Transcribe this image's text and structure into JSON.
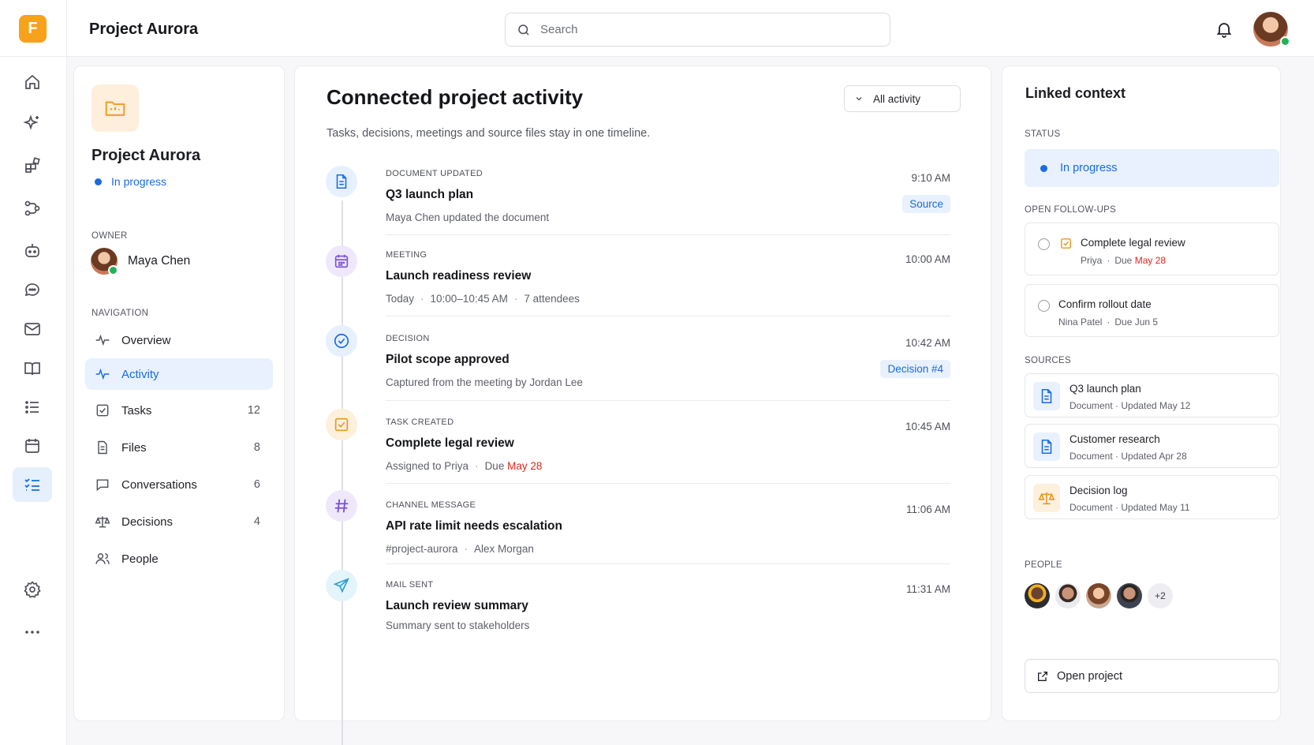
{
  "app": {
    "logo_letter": "F",
    "title": "Project Aurora"
  },
  "search": {
    "placeholder": "Search"
  },
  "rail": {
    "items": [
      {
        "name": "home-icon"
      },
      {
        "name": "sparkle-icon"
      },
      {
        "name": "apps-icon"
      },
      {
        "name": "workflow-icon"
      },
      {
        "name": "bot-icon"
      },
      {
        "name": "chat-icon"
      },
      {
        "name": "mail-icon"
      },
      {
        "name": "book-icon"
      },
      {
        "name": "list-icon"
      },
      {
        "name": "calendar-icon"
      },
      {
        "name": "checklist-icon",
        "active": true
      }
    ],
    "bottom": [
      {
        "name": "settings-icon"
      },
      {
        "name": "more-icon"
      }
    ]
  },
  "project": {
    "name": "Project Aurora",
    "status": "In progress",
    "owner_label": "OWNER",
    "owner_name": "Maya Chen",
    "nav_label": "NAVIGATION",
    "nav": [
      {
        "label": "Overview",
        "count": ""
      },
      {
        "label": "Activity",
        "count": "",
        "active": true
      },
      {
        "label": "Tasks",
        "count": "12"
      },
      {
        "label": "Files",
        "count": "8"
      },
      {
        "label": "Conversations",
        "count": "6"
      },
      {
        "label": "Decisions",
        "count": "4"
      },
      {
        "label": "People",
        "count": ""
      }
    ]
  },
  "main": {
    "title": "Connected project activity",
    "filter_label": "All activity",
    "subtitle": "Tasks, decisions, meetings and source files stay in one timeline.",
    "events": [
      {
        "type": "DOCUMENT UPDATED",
        "title": "Q3 launch plan",
        "meta": [
          "Maya Chen updated the document"
        ],
        "time": "9:10 AM",
        "tag": "Source"
      },
      {
        "type": "MEETING",
        "title": "Launch readiness review",
        "meta": [
          "Today",
          "10:00–10:45 AM",
          "7 attendees"
        ],
        "time": "10:00 AM"
      },
      {
        "type": "DECISION",
        "title": "Pilot scope approved",
        "meta": [
          "Captured from the meeting by Jordan Lee"
        ],
        "time": "10:42 AM",
        "tag": "Decision #4"
      },
      {
        "type": "TASK CREATED",
        "title": "Complete legal review",
        "meta_a": "Assigned to Priya",
        "meta_b": "Due",
        "meta_due": "May 28",
        "time": "10:45 AM"
      },
      {
        "type": "CHANNEL MESSAGE",
        "title": "API rate limit needs escalation",
        "meta": [
          "#project-aurora",
          "Alex Morgan"
        ],
        "time": "11:06 AM"
      },
      {
        "type": "MAIL SENT",
        "title": "Launch review summary",
        "meta": [
          "Summary sent to stakeholders"
        ],
        "time": "11:31 AM"
      }
    ]
  },
  "context": {
    "title": "Linked context",
    "status_label": "STATUS",
    "status": "In progress",
    "followups_label": "OPEN FOLLOW-UPS",
    "followups": [
      {
        "title": "Complete legal review",
        "who": "Priya",
        "due_prefix": "Due",
        "due": "May 28"
      },
      {
        "title": "Confirm rollout date",
        "who": "Nina Patel",
        "due_prefix": "Due",
        "due": "Jun 5"
      }
    ],
    "sources_label": "SOURCES",
    "sources": [
      {
        "title": "Q3 launch plan",
        "meta": "Document · Updated May 12",
        "icon": "document-icon"
      },
      {
        "title": "Customer research",
        "meta": "Document · Updated Apr 28",
        "icon": "document-icon"
      },
      {
        "title": "Decision log",
        "meta": "Document · Updated May 11",
        "icon": "scale-icon"
      }
    ],
    "people_label": "PEOPLE",
    "people_more": "+2",
    "open_label": "Open project"
  },
  "colors": {
    "accent": "#1a6be0",
    "brand": "#f7a21b",
    "due_red": "#e0271b",
    "online": "#22b35a"
  }
}
